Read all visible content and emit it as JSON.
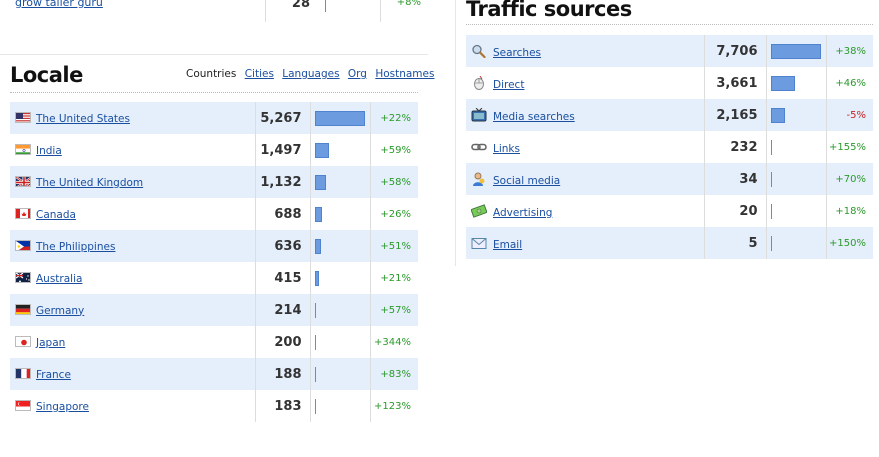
{
  "top_row": {
    "keyword": "grow taller guru",
    "count": "28",
    "change": "+8%"
  },
  "locale": {
    "title": "Locale",
    "tabs": [
      {
        "label": "Countries",
        "active": true
      },
      {
        "label": "Cities",
        "active": false
      },
      {
        "label": "Languages",
        "active": false
      },
      {
        "label": "Org",
        "active": false
      },
      {
        "label": "Hostnames",
        "active": false
      }
    ],
    "rows": [
      {
        "country": "The United States",
        "flag": "us-flag-icon",
        "count": "5,267",
        "share": 1.0,
        "change": "+22%"
      },
      {
        "country": "India",
        "flag": "india-flag-icon",
        "count": "1,497",
        "share": 0.284,
        "change": "+59%"
      },
      {
        "country": "The United Kingdom",
        "flag": "uk-flag-icon",
        "count": "1,132",
        "share": 0.215,
        "change": "+58%"
      },
      {
        "country": "Canada",
        "flag": "canada-flag-icon",
        "count": "688",
        "share": 0.131,
        "change": "+26%"
      },
      {
        "country": "The Philippines",
        "flag": "philippines-flag-icon",
        "count": "636",
        "share": 0.121,
        "change": "+51%"
      },
      {
        "country": "Australia",
        "flag": "australia-flag-icon",
        "count": "415",
        "share": 0.079,
        "change": "+21%"
      },
      {
        "country": "Germany",
        "flag": "germany-flag-icon",
        "count": "214",
        "share": 0.041,
        "change": "+57%"
      },
      {
        "country": "Japan",
        "flag": "japan-flag-icon",
        "count": "200",
        "share": 0.038,
        "change": "+344%"
      },
      {
        "country": "France",
        "flag": "france-flag-icon",
        "count": "188",
        "share": 0.036,
        "change": "+83%"
      },
      {
        "country": "Singapore",
        "flag": "singapore-flag-icon",
        "count": "183",
        "share": 0.035,
        "change": "+123%"
      }
    ]
  },
  "traffic": {
    "title": "Traffic sources",
    "rows": [
      {
        "source": "Searches",
        "icon": "magnifier-icon",
        "count": "7,706",
        "share": 1.0,
        "change": "+38%",
        "negative": false
      },
      {
        "source": "Direct",
        "icon": "cursor-icon",
        "count": "3,661",
        "share": 0.475,
        "change": "+46%",
        "negative": false
      },
      {
        "source": "Media searches",
        "icon": "tv-icon",
        "count": "2,165",
        "share": 0.281,
        "change": "-5%",
        "negative": true
      },
      {
        "source": "Links",
        "icon": "chain-link-icon",
        "count": "232",
        "share": 0.03,
        "change": "+155%",
        "negative": false
      },
      {
        "source": "Social media",
        "icon": "person-icon",
        "count": "34",
        "share": 0.004,
        "change": "+70%",
        "negative": false
      },
      {
        "source": "Advertising",
        "icon": "money-icon",
        "count": "20",
        "share": 0.003,
        "change": "+18%",
        "negative": false
      },
      {
        "source": "Email",
        "icon": "envelope-icon",
        "count": "5",
        "share": 0.001,
        "change": "+150%",
        "negative": false
      }
    ]
  },
  "colors": {
    "link": "#1a4fa0",
    "row_alt": "#e5effc",
    "bar": "#6d9be0",
    "positive": "#2a9a2a",
    "negative": "#cc2222"
  }
}
